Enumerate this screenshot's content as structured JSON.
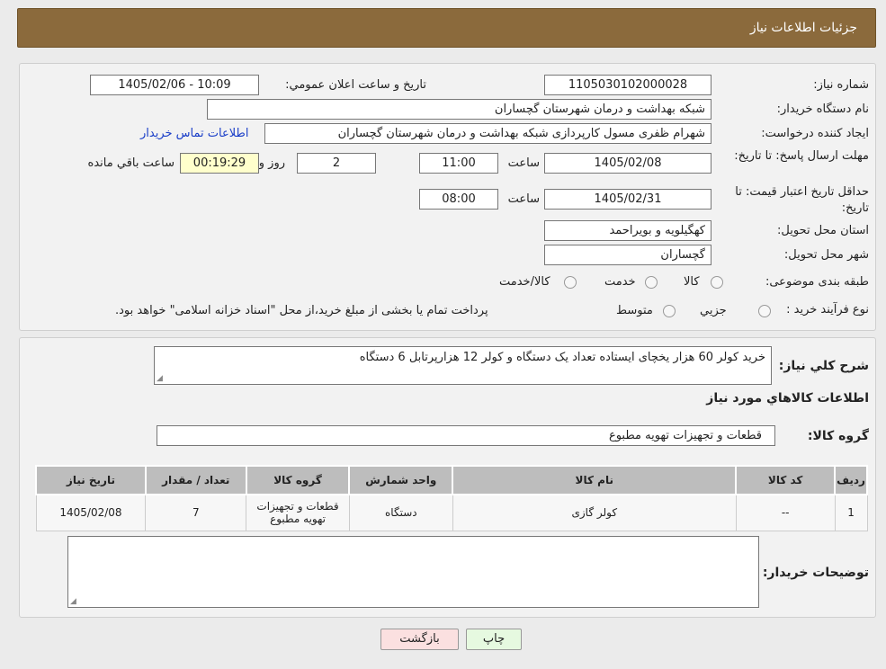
{
  "header": {
    "title": "جزئیات اطلاعات نیاز"
  },
  "form": {
    "need_number_label": "شماره نیاز:",
    "need_number": "1105030102000028",
    "announce_label": "تاریخ و ساعت اعلان عمومي:",
    "announce_value": "1405/02/06 - 10:09",
    "buyer_org_label": "نام دستگاه خریدار:",
    "buyer_org": "شبکه بهداشت و درمان شهرستان گچساران",
    "creator_label": "ایجاد کننده درخواست:",
    "creator": "شهرام ظفری مسول کارپردازی  شبکه بهداشت و درمان شهرستان گچساران",
    "contact_link": "اطلاعات تماس خریدار",
    "deadline_label": "مهلت ارسال پاسخ: تا تاریخ:",
    "deadline_date": "1405/02/08",
    "time_label": "ساعت",
    "deadline_time": "11:00",
    "days_value": "2",
    "days_label": "روز و",
    "remaining_value": "00:19:29",
    "remaining_label": "ساعت باقي مانده",
    "validity_label": "حداقل تاریخ اعتبار قیمت: تا تاریخ:",
    "validity_date": "1405/02/31",
    "validity_time": "08:00",
    "province_label": "استان محل تحویل:",
    "province": "کهگیلویه و بویراحمد",
    "city_label": "شهر محل تحویل:",
    "city": "گچساران",
    "category_label": "طبقه بندی موضوعی:",
    "category_options": [
      "کالا",
      "خدمت",
      "کالا/خدمت"
    ],
    "process_label": "نوع فرآیند خرید :",
    "process_options": [
      "جزیي",
      "متوسط"
    ],
    "process_note": "پرداخت تمام یا بخشی از مبلغ خرید،از محل \"اسناد خزانه اسلامی\" خواهد بود."
  },
  "details": {
    "summary_label": "شرح کلي نیاز:",
    "summary": "خرید کولر 60 هزار یخچای ایستاده تعداد یک دستگاه و کولر 12 هزارپرتابل  6 دستگاه",
    "goods_info_title": "اطلاعات کالاهاي مورد نیاز",
    "goods_group_label": "گروه کالا:",
    "goods_group": "قطعات و تجهیزات تهویه مطبوع"
  },
  "table": {
    "headers": [
      "ردیف",
      "کد کالا",
      "نام کالا",
      "واحد شمارش",
      "گروه کالا",
      "تعداد / مقدار",
      "تاریخ نیاز"
    ],
    "rows": [
      [
        "1",
        "--",
        "کولر گازی",
        "دستگاه",
        "قطعات و تجهیزات تهویه مطبوع",
        "7",
        "1405/02/08"
      ]
    ]
  },
  "buyer_notes_label": "توضیحات خریدار:",
  "buttons": {
    "print": "چاپ",
    "back": "بازگشت"
  },
  "colors": {
    "header_bg": "#8b6a3c",
    "link": "#1a3ec8",
    "remaining_bg": "#ffffcc"
  }
}
